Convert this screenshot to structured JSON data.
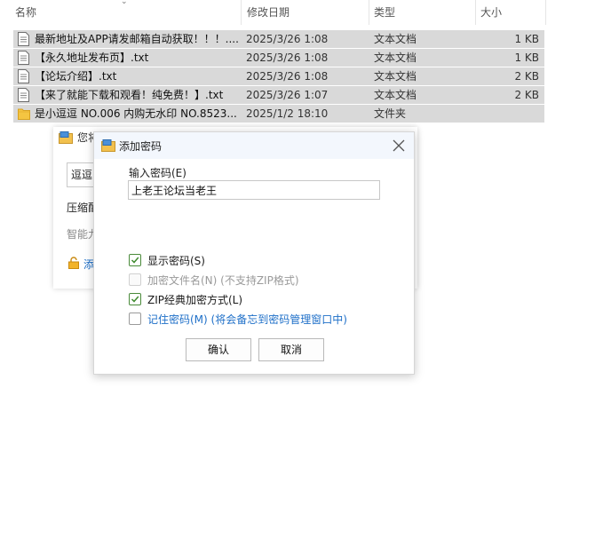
{
  "file_list": {
    "columns": {
      "name": "名称",
      "date": "修改日期",
      "type": "类型",
      "size": "大小"
    },
    "rows": [
      {
        "name": "最新地址及APP请发邮箱自动获取！！！....",
        "date": "2025/3/26 1:08",
        "type": "文本文档",
        "size": "1 KB",
        "icon": "text-file-icon"
      },
      {
        "name": "【永久地址发布页】.txt",
        "date": "2025/3/26 1:08",
        "type": "文本文档",
        "size": "1 KB",
        "icon": "text-file-icon"
      },
      {
        "name": "【论坛介绍】.txt",
        "date": "2025/3/26 1:08",
        "type": "文本文档",
        "size": "2 KB",
        "icon": "text-file-icon"
      },
      {
        "name": "【来了就能下载和观看！纯免费！】.txt",
        "date": "2025/3/26 1:07",
        "type": "文本文档",
        "size": "2 KB",
        "icon": "text-file-icon"
      },
      {
        "name": "是小逗逗 NO.006 内购无水印 NO.8523...",
        "date": "2025/1/2 18:10",
        "type": "文件夹",
        "size": "",
        "icon": "folder-icon"
      }
    ]
  },
  "bg_dialog": {
    "title": "您将",
    "field_value": "逗逗",
    "label": "压缩配",
    "hint": "智能九",
    "link": "添"
  },
  "dialog": {
    "title": "添加密码",
    "password_label": "输入密码(E)",
    "password_value": "上老王论坛当老王",
    "options": {
      "show_password": "显示密码(S)",
      "encrypt_names": "加密文件名(N) (不支持ZIP格式)",
      "zip_classic": "ZIP经典加密方式(L)",
      "remember": "记住密码(M) (将会备忘到密码管理窗口中)"
    },
    "ok": "确认",
    "cancel": "取消"
  },
  "colors": {
    "accent": "#1e6fc8",
    "check": "#3f8a2e",
    "row_selected": "#d9d9d9"
  }
}
